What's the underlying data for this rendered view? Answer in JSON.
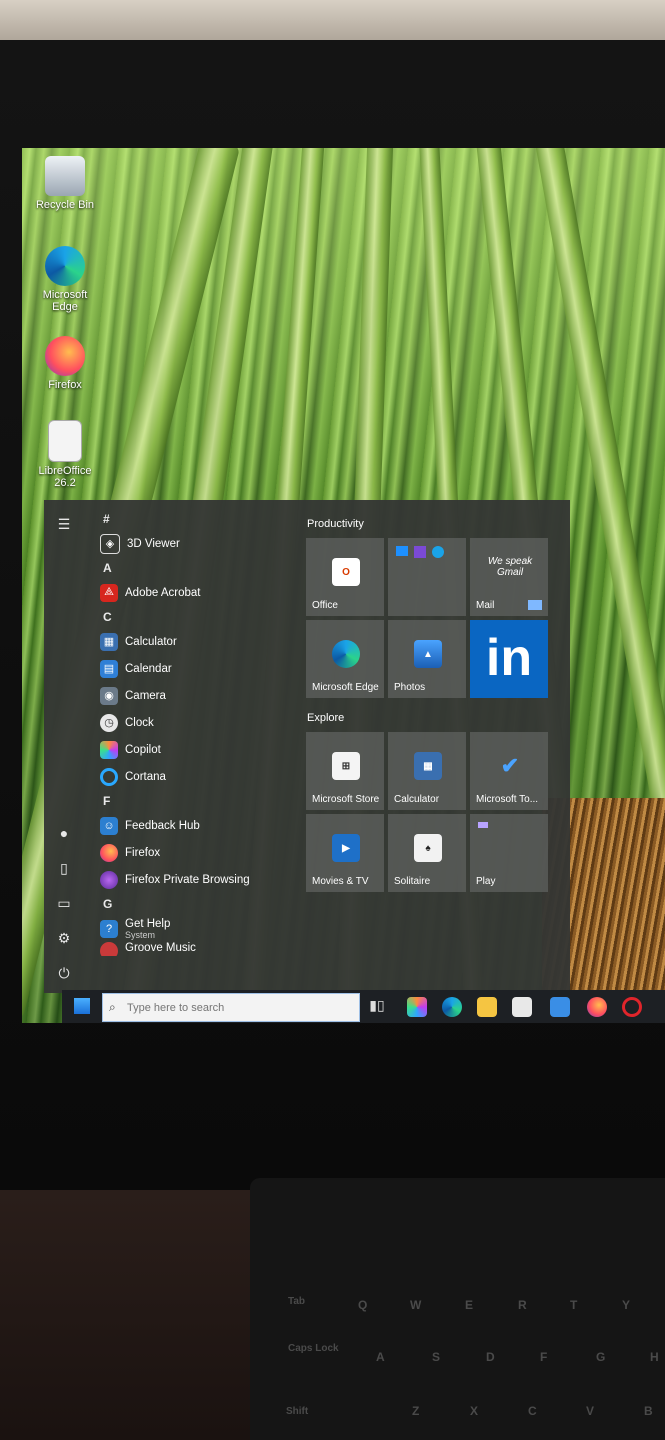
{
  "desktop": {
    "icons": [
      {
        "label": "Recycle Bin"
      },
      {
        "label": "Microsoft Edge"
      },
      {
        "label": "Firefox"
      },
      {
        "label": "LibreOffice 26.2"
      }
    ]
  },
  "start_menu": {
    "app_list": {
      "sections": [
        {
          "letter": "#",
          "apps": [
            {
              "label": "3D Viewer",
              "icon": "cube-icon"
            }
          ]
        },
        {
          "letter": "A",
          "apps": [
            {
              "label": "Adobe Acrobat",
              "icon": "acrobat-icon"
            }
          ]
        },
        {
          "letter": "C",
          "apps": [
            {
              "label": "Calculator",
              "icon": "calculator-icon"
            },
            {
              "label": "Calendar",
              "icon": "calendar-icon"
            },
            {
              "label": "Camera",
              "icon": "camera-icon"
            },
            {
              "label": "Clock",
              "icon": "clock-icon"
            },
            {
              "label": "Copilot",
              "icon": "copilot-icon"
            },
            {
              "label": "Cortana",
              "icon": "cortana-icon"
            }
          ]
        },
        {
          "letter": "F",
          "apps": [
            {
              "label": "Feedback Hub",
              "icon": "feedback-icon"
            },
            {
              "label": "Firefox",
              "icon": "firefox-icon"
            },
            {
              "label": "Firefox Private Browsing",
              "icon": "firefox-private-icon"
            }
          ]
        },
        {
          "letter": "G",
          "apps": [
            {
              "label": "Get Help",
              "sub": "System",
              "icon": "help-icon"
            },
            {
              "label": "Groove Music",
              "icon": "music-icon"
            }
          ]
        }
      ]
    },
    "groups": [
      {
        "title": "Productivity",
        "tiles": [
          {
            "label": "Office"
          },
          {
            "label": ""
          },
          {
            "label": "Mail",
            "text": "We speak Gmail"
          },
          {
            "label": "Microsoft Edge"
          },
          {
            "label": "Photos"
          },
          {
            "label": "",
            "brand": "in"
          }
        ]
      },
      {
        "title": "Explore",
        "tiles": [
          {
            "label": "Microsoft Store"
          },
          {
            "label": "Calculator"
          },
          {
            "label": "Microsoft To..."
          },
          {
            "label": "Movies & TV"
          },
          {
            "label": "Solitaire"
          },
          {
            "label": "Play"
          }
        ]
      }
    ]
  },
  "taskbar": {
    "search_placeholder": "Type here to search"
  },
  "keyboard": {
    "rows": [
      [
        "Tab",
        "Q",
        "W",
        "E",
        "R",
        "T",
        "Y"
      ],
      [
        "Caps Lock",
        "A",
        "S",
        "D",
        "F",
        "G",
        "H"
      ],
      [
        "Shift",
        "Z",
        "X",
        "C",
        "V",
        "B"
      ]
    ]
  },
  "colors": {
    "start_bg": "#343634",
    "tile_bg": "#5f625f",
    "linkedin": "#0a66c2",
    "taskbar": "#1d2024"
  }
}
